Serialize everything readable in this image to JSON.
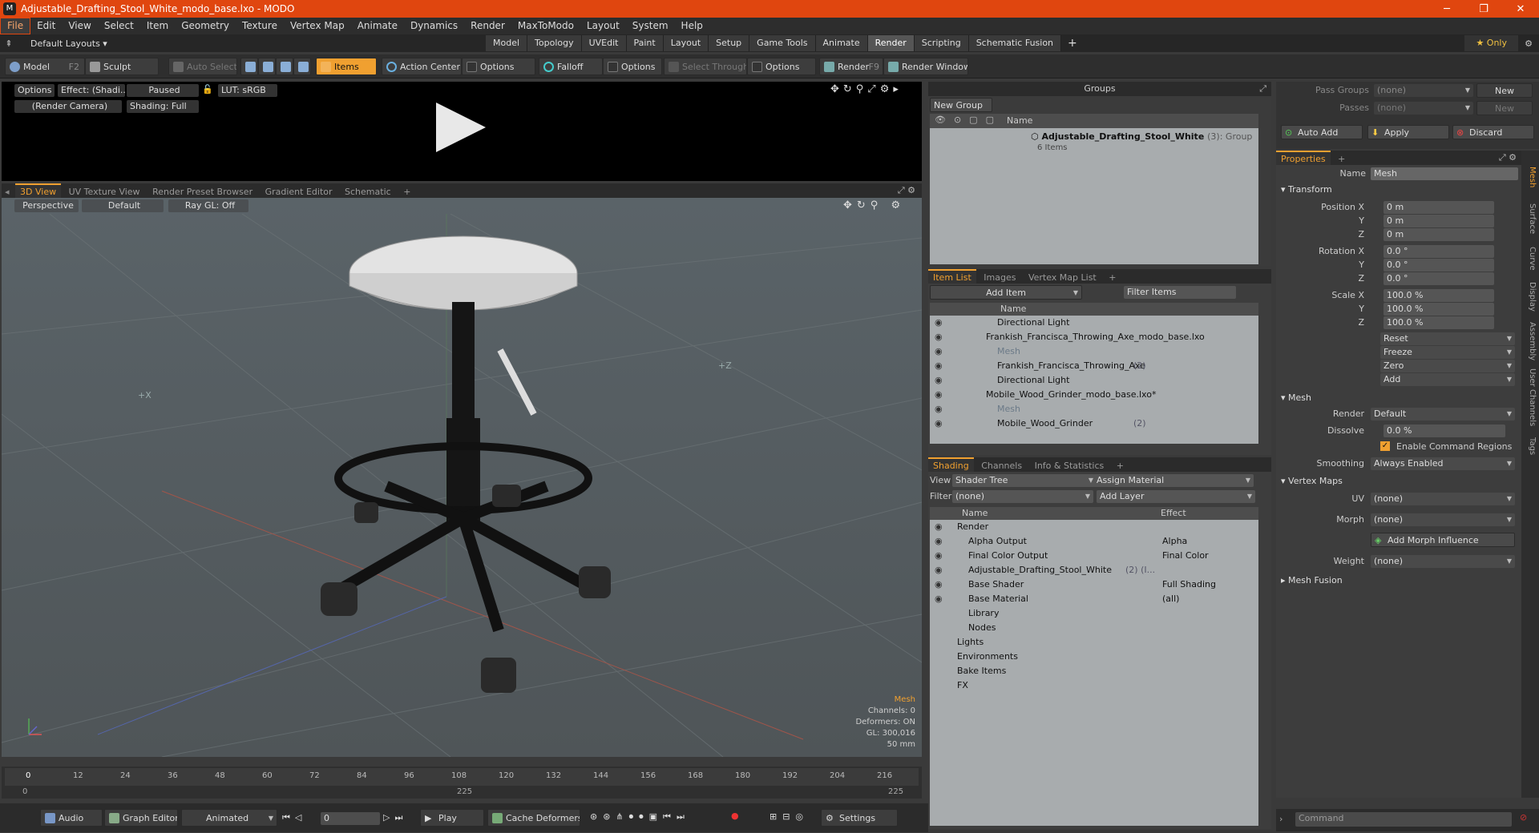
{
  "window": {
    "title": "Adjustable_Drafting_Stool_White_modo_base.lxo - MODO",
    "logo": "M",
    "controls": [
      "─",
      "❐",
      "✕"
    ]
  },
  "menu": [
    "File",
    "Edit",
    "View",
    "Select",
    "Item",
    "Geometry",
    "Texture",
    "Vertex Map",
    "Animate",
    "Dynamics",
    "Render",
    "MaxToModo",
    "Layout",
    "System",
    "Help"
  ],
  "layouts": {
    "default": "Default Layouts ▾",
    "tabs": [
      "Model",
      "Topology",
      "UVEdit",
      "Paint",
      "Layout",
      "Setup",
      "Game Tools",
      "Animate",
      "Render",
      "Scripting",
      "Schematic Fusion"
    ],
    "active": "Render",
    "only": "★ Only"
  },
  "toolbar": {
    "model": "Model",
    "model_key": "F2",
    "sculpt": "Sculpt",
    "auto_select": "Auto Select",
    "items": "Items",
    "action_center": "Action Center",
    "options": "Options",
    "falloff": "Falloff",
    "options2": "Options",
    "select_through": "Select Through",
    "options3": "Options",
    "render": "Render",
    "render_key": "F9",
    "render_window": "Render Window"
  },
  "preview": {
    "options": "Options",
    "effect": "Effect: (Shadi...",
    "paused": "Paused",
    "lut": "LUT: sRGB",
    "camera": "(Render Camera)",
    "shading": "Shading: Full"
  },
  "viewport": {
    "tabs": [
      "3D View",
      "UV Texture View",
      "Render Preset Browser",
      "Gradient Editor",
      "Schematic"
    ],
    "perspective": "Perspective",
    "default": "Default",
    "raygl": "Ray GL: Off",
    "axis_x": "+X",
    "axis_z": "+Z",
    "info": {
      "mesh": "Mesh",
      "channels": "Channels: 0",
      "deformers": "Deformers: ON",
      "gl": "GL: 300,016",
      "mm": "50 mm"
    }
  },
  "timeline": {
    "ticks": [
      "0",
      "12",
      "24",
      "36",
      "48",
      "60",
      "72",
      "84",
      "96",
      "108",
      "120",
      "132",
      "144",
      "156",
      "168",
      "180",
      "192",
      "204",
      "216"
    ],
    "start": "0",
    "mid": "225",
    "end": "225"
  },
  "bottombar": {
    "audio": "Audio",
    "graph_editor": "Graph Editor",
    "animated": "Animated",
    "frame": "0",
    "play": "Play",
    "cache": "Cache Deformers",
    "settings": "Settings"
  },
  "groups": {
    "title": "Groups",
    "new_group": "New Group",
    "col_name": "Name",
    "item": "Adjustable_Drafting_Stool_White",
    "item_count": "(3)",
    "item_type": ": Group",
    "sub": "6 Items"
  },
  "itemlist": {
    "tabs": [
      "Item List",
      "Images",
      "Vertex Map List"
    ],
    "add_item": "Add Item",
    "filter": "Filter Items",
    "col_name": "Name",
    "rows": [
      {
        "indent": 2,
        "text": "Directional Light",
        "dim": false
      },
      {
        "indent": 1,
        "text": "Frankish_Francisca_Throwing_Axe_modo_base.lxo",
        "dim": false
      },
      {
        "indent": 2,
        "text": "Mesh",
        "dim": true
      },
      {
        "indent": 2,
        "text": "Frankish_Francisca_Throwing_Axe",
        "extra": "(2)",
        "dim": false
      },
      {
        "indent": 2,
        "text": "Directional Light",
        "dim": false
      },
      {
        "indent": 1,
        "text": "Mobile_Wood_Grinder_modo_base.lxo*",
        "dim": false
      },
      {
        "indent": 2,
        "text": "Mesh",
        "dim": true
      },
      {
        "indent": 2,
        "text": "Mobile_Wood_Grinder",
        "extra": "(2)",
        "dim": false
      }
    ]
  },
  "shading": {
    "tabs": [
      "Shading",
      "Channels",
      "Info & Statistics"
    ],
    "view_label": "View",
    "view_value": "Shader Tree",
    "assign": "Assign Material",
    "filter_label": "Filter",
    "filter_value": "(none)",
    "add_layer": "Add Layer",
    "col_name": "Name",
    "col_effect": "Effect",
    "rows": [
      {
        "indent": 0,
        "text": "Render",
        "effect": ""
      },
      {
        "indent": 1,
        "text": "Alpha Output",
        "effect": "Alpha"
      },
      {
        "indent": 1,
        "text": "Final Color Output",
        "effect": "Final Color"
      },
      {
        "indent": 1,
        "text": "Adjustable_Drafting_Stool_White",
        "extra": "(2) (I...",
        "effect": ""
      },
      {
        "indent": 1,
        "text": "Base Shader",
        "effect": "Full Shading"
      },
      {
        "indent": 1,
        "text": "Base Material",
        "effect": "(all)"
      },
      {
        "indent": 1,
        "text": "Library",
        "effect": ""
      },
      {
        "indent": 1,
        "text": "Nodes",
        "effect": ""
      },
      {
        "indent": 0,
        "text": "Lights",
        "effect": ""
      },
      {
        "indent": 0,
        "text": "Environments",
        "effect": ""
      },
      {
        "indent": 0,
        "text": "Bake Items",
        "effect": ""
      },
      {
        "indent": 0,
        "text": "FX",
        "effect": ""
      }
    ]
  },
  "passes": {
    "pass_groups": "Pass Groups",
    "passes": "Passes",
    "none": "(none)",
    "new": "New",
    "auto_add": "Auto Add",
    "apply": "Apply",
    "discard": "Discard"
  },
  "properties": {
    "tab": "Properties",
    "name_label": "Name",
    "name_value": "Mesh",
    "transform": "Transform",
    "position": [
      "0 m",
      "0 m",
      "0 m"
    ],
    "rotation": [
      "0.0 °",
      "0.0 °",
      "0.0 °"
    ],
    "scale": [
      "100.0 %",
      "100.0 %",
      "100.0 %"
    ],
    "pos_label": "Position X",
    "rot_label": "Rotation X",
    "scale_label": "Scale X",
    "y": "Y",
    "z": "Z",
    "actions": [
      "Reset",
      "Freeze",
      "Zero",
      "Add"
    ],
    "mesh": "Mesh",
    "render_label": "Render",
    "render_value": "Default",
    "dissolve_label": "Dissolve",
    "dissolve_value": "0.0 %",
    "enable_cmd": "Enable Command Regions",
    "smoothing_label": "Smoothing",
    "smoothing_value": "Always Enabled",
    "vertex_maps": "Vertex Maps",
    "uv_label": "UV",
    "uv_value": "(none)",
    "morph_label": "Morph",
    "morph_value": "(none)",
    "add_morph": "Add Morph Influence",
    "weight_label": "Weight",
    "weight_value": "(none)",
    "mesh_fusion": "Mesh Fusion",
    "vtabs": [
      "Mesh",
      "Surface",
      "Curve",
      "Display",
      "Assembly",
      "User Channels",
      "Tags"
    ],
    "command": "Command"
  }
}
